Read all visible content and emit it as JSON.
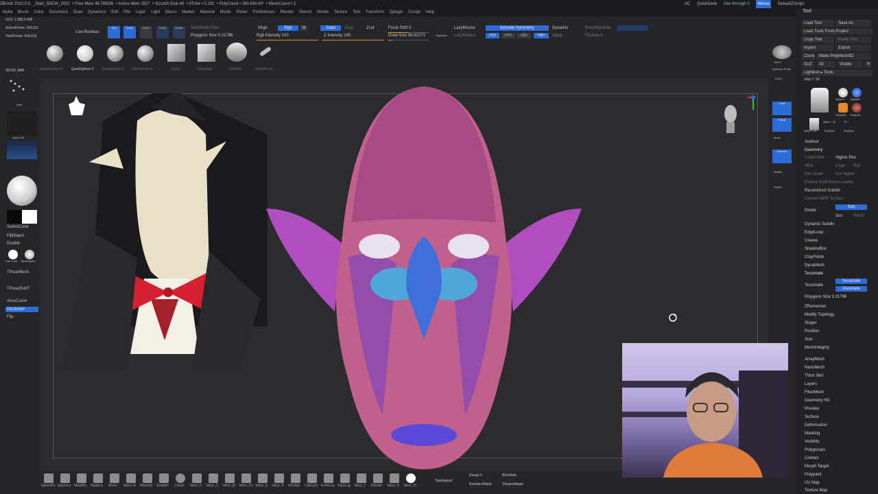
{
  "titlebar": {
    "segments": [
      "ZBrush 2022.0.5",
      "_Start_3DCW_2022",
      "• Free Mem 46.788GB",
      "• Active Mem 1527",
      "• Scratch Disk 49",
      "• ATime • 0.192",
      "• PolyCount • 280.634 KP",
      "• MeshCount • 2"
    ],
    "right_items": [
      "AC",
      "QuickSave",
      "See-through 0",
      "Menus",
      "DefaultZScript"
    ]
  },
  "menubar": [
    "Alpha",
    "Brush",
    "Color",
    "Document",
    "Draw",
    "Dynamics",
    "Edit",
    "File",
    "Layer",
    "Light",
    "Macro",
    "Marker",
    "Material",
    "Movie",
    "Picker",
    "Preferences",
    "Render",
    "Stencil",
    "Stroke",
    "Texture",
    "Tool",
    "Transform",
    "Zplugin",
    "Zscript",
    "Help"
  ],
  "stats": [
    "0.63,-1.358,0.408",
    "ActivePoints: 256,011",
    "TotalPoints: 504,419"
  ],
  "top": {
    "live_boolean": "Live Boolean",
    "edit": "Edit",
    "draw": "Draw",
    "move": "Move",
    "scale": "Scale",
    "rotate": "Rotate",
    "subdivide_size": "SubDivide Size",
    "polygons_size": "Polygons Size 0.21796",
    "mrgb": "Mrgb",
    "rgb": "Rgb",
    "m": "M",
    "rgb_intensity": "Rgb Intensity 100",
    "rgb_intensity_value": 1.0,
    "zadd": "Zadd",
    "zsub": "Zsub",
    "zcut": "Zcut",
    "z_intensity": "Z Intensity 100",
    "z_intensity_value": 1.0,
    "focal_shift": "Focal Shift 0",
    "focal_shift_value": 0.5,
    "draw_size": "Draw Size 86.82372",
    "draw_size_value": 0.1,
    "dynamic": "Dynamic",
    "lazymouse": "LazyMouse",
    "lazyradius": "LazyRadius",
    "activate_symmetry": "Activate Symmetry",
    "sym_x": ">X<",
    "sym_y": ">Y<",
    "sym_z": ">Z<",
    "sym_m": ">M<",
    "smoothsubdiv": "SmoothSubdiv",
    "thickness": "Thickness",
    "apply": "Apply"
  },
  "brushes": [
    "QuadSphere-4",
    "QuadSphere-2",
    "QuadSphere-3",
    "DiskSphere-4",
    "Cube",
    "CubeSub",
    "Cylinder",
    "AlphaBrush"
  ],
  "left": {
    "brush_name": "3DCW_IMM",
    "dots": "Dots",
    "alpha": "Alpha Off",
    "switch_color": "SwitchColor",
    "fill_object": "FillObject",
    "double": "Double",
    "flat_color": "Flat Color",
    "skin_shade": "SkinShade4",
    "tpose_mesh": "TPoseMesh",
    "tpose_subt": "TPose|SubT",
    "accucurve": "AccuCurve",
    "occlusion": "Occlusion",
    "flip": "Flip"
  },
  "right_shelf": [
    "Spix 3",
    "Dynamic Persp",
    "Floor",
    "Local",
    "Frame",
    "Move",
    "Zoom3D",
    "Rotate",
    "Line Fill PolyF",
    "Transp",
    "Dynamic Solo",
    "Xpose"
  ],
  "toolpanel": {
    "title": "Tool",
    "buttons": [
      "Load Tool",
      "Save As",
      "Load Tools From Project",
      "Copy Tool",
      "Paste Tool",
      "Import",
      "Export",
      "Clone",
      "Make PolyMesh3D",
      "GoZ",
      "All",
      "Visible",
      "R"
    ],
    "lightbox": "Lightbox ▸ Tools",
    "step": "Step 1. 50",
    "thumbs": [
      "Step 1. 50",
      "Sphere",
      "AlphaBr",
      "SimpleB",
      "EraserB",
      "Step 1. 14",
      "19",
      "Step 1. 19",
      "PolySph",
      "PolySph"
    ],
    "subtool": "Subtool",
    "geometry": "Geometry",
    "geo_items": [
      "Lower Res",
      "Higher Res",
      "SDiv",
      "Cage",
      "Rstr",
      "Del Lower",
      "Del Higher",
      "Freeze SubDivision Levels",
      "Reconstruct Subdiv",
      "Convert BPR To Geo",
      "Divide",
      "Smt",
      "Suv",
      "ReUV",
      "Dynamic Subdiv",
      "EdgeLoop",
      "Crease",
      "ShadowBox",
      "ClayPolish",
      "DynaMesh",
      "Tessimate",
      "Tessimate",
      "Tessimate",
      "Decimate",
      "Polygons Size 0.21796",
      "ZRemesher",
      "Modify Topology",
      "Stager",
      "Position",
      "Size",
      "MeshIntegrity"
    ],
    "sections": [
      "ArrayMesh",
      "NanoMesh",
      "Thick Skin",
      "Layers",
      "FiberMesh",
      "Geometry HD",
      "Preview",
      "Surface",
      "Deformation",
      "Masking",
      "Visibility",
      "Polygroups",
      "Contact",
      "Morph Target",
      "Polypaint",
      "UV Map",
      "Texture Map"
    ]
  },
  "bottom_brushes": [
    "SelectRe",
    "SelectLa",
    "MaskPe",
    "MaskLa",
    "Move",
    "Move El",
    "MoveInf",
    "SnakeH",
    "Chisel",
    "3dcw_H",
    "3dcw_C",
    "3dcw_Dr",
    "3dcw_Ch",
    "3dcw_S",
    "3dcw_P",
    "NPolish",
    "ClipCurv",
    "KnifeLas",
    "TopoLog",
    "3dcw_T",
    "ZModel",
    "3dcw_H",
    "3dcw_Cl"
  ],
  "bottom_right": {
    "topological": "Topological",
    "range": "Range 5",
    "blur_mask": "BlurMask",
    "backface_mask": "BackfaceMask",
    "sharpen_mask": "SharpenMask"
  },
  "colors": {
    "accent": "#2d6bd6",
    "slider": "#d89a2a",
    "head": "#c0608c",
    "ears": "#b04ec0",
    "nose": "#3f6fd8"
  },
  "icons": [
    "pointer-hand-icon",
    "navigation-gizmo-icon",
    "head-preview-icon",
    "rotate-cursor-icon"
  ]
}
